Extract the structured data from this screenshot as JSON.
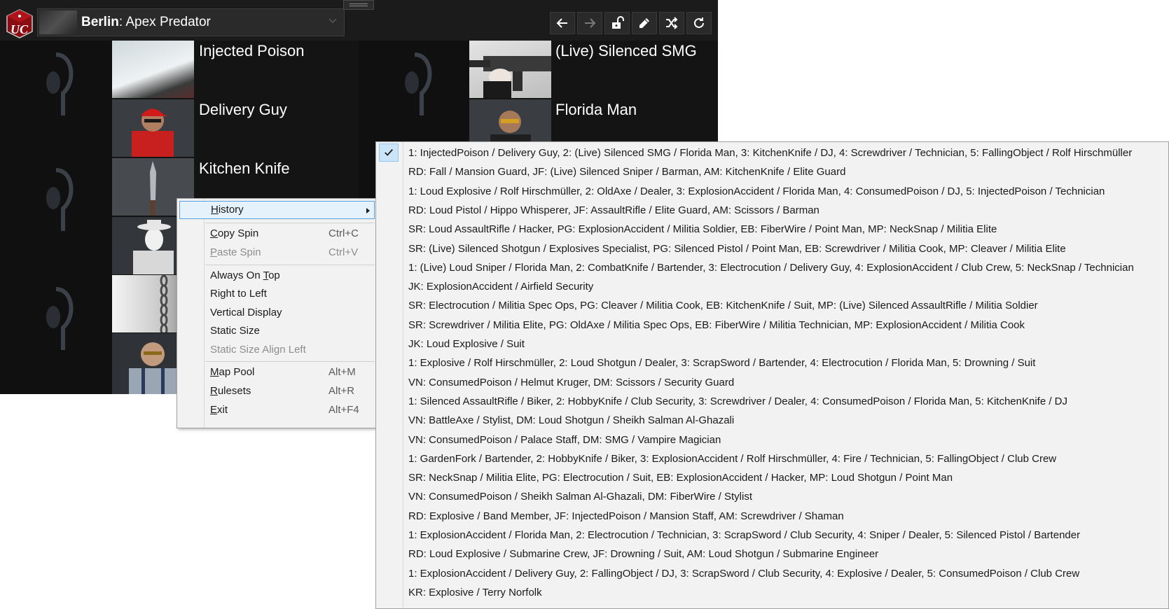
{
  "app": {
    "mission": {
      "location": "Berlin",
      "name": "Apex Predator"
    },
    "toolbar_buttons": [
      "back-arrow-icon",
      "forward-arrow-icon",
      "unlock-icon",
      "pencil-icon",
      "shuffle-icon",
      "refresh-icon"
    ]
  },
  "spin": {
    "left_column": [
      {
        "name": "Injected Poison"
      },
      {
        "name": "Delivery Guy"
      },
      {
        "name": "Kitchen Knife"
      }
    ],
    "right_column": [
      {
        "name": "(Live) Silenced SMG"
      },
      {
        "name": "Florida Man"
      }
    ]
  },
  "context_menu": {
    "items": [
      {
        "label": "History",
        "accel": "H",
        "rest": "istory",
        "shortcut": "",
        "submenu": true,
        "enabled": true
      },
      {
        "label": "Copy Spin",
        "accel": "C",
        "rest": "opy Spin",
        "shortcut": "Ctrl+C",
        "enabled": true
      },
      {
        "label": "Paste Spin",
        "accel": "P",
        "rest": "aste Spin",
        "shortcut": "Ctrl+V",
        "enabled": false
      },
      {
        "label_pre": "Always On ",
        "accel": "T",
        "rest": "op",
        "shortcut": "",
        "enabled": true
      },
      {
        "label": "Right to Left",
        "shortcut": "",
        "enabled": true
      },
      {
        "label": "Vertical Display",
        "shortcut": "",
        "enabled": true
      },
      {
        "label": "Static Size",
        "shortcut": "",
        "enabled": true
      },
      {
        "label": "Static Size Align Left",
        "shortcut": "",
        "enabled": false
      },
      {
        "label": "Map Pool",
        "accel": "M",
        "rest": "ap Pool",
        "shortcut": "Alt+M",
        "enabled": true
      },
      {
        "label": "Rulesets",
        "accel": "R",
        "rest": "ulesets",
        "shortcut": "Alt+R",
        "enabled": true
      },
      {
        "label": "Exit",
        "accel": "E",
        "rest": "xit",
        "shortcut": "Alt+F4",
        "enabled": true
      }
    ]
  },
  "history": {
    "checked_index": 0,
    "entries": [
      "1: InjectedPoison / Delivery Guy, 2: (Live) Silenced SMG / Florida Man, 3: KitchenKnife / DJ, 4: Screwdriver / Technician, 5: FallingObject / Rolf Hirschmüller",
      "RD: Fall / Mansion Guard, JF: (Live) Silenced Sniper / Barman, AM: KitchenKnife / Elite Guard",
      "1: Loud Explosive / Rolf Hirschmüller, 2: OldAxe / Dealer, 3: ExplosionAccident / Florida Man, 4: ConsumedPoison / DJ, 5: InjectedPoison / Technician",
      "RD: Loud Pistol / Hippo Whisperer, JF: AssaultRifle / Elite Guard, AM: Scissors / Barman",
      "SR: Loud AssaultRifle / Hacker, PG: ExplosionAccident / Militia Soldier, EB: FiberWire / Point Man, MP: NeckSnap / Militia Elite",
      "SR: (Live) Silenced Shotgun / Explosives Specialist, PG: Silenced Pistol / Point Man, EB: Screwdriver / Militia Cook, MP: Cleaver / Militia Elite",
      "1: (Live) Loud Sniper / Florida Man, 2: CombatKnife / Bartender, 3: Electrocution / Delivery Guy, 4: ExplosionAccident / Club Crew, 5: NeckSnap / Technician",
      "JK: ExplosionAccident / Airfield Security",
      "SR: Electrocution / Militia Spec Ops, PG: Cleaver / Militia Cook, EB: KitchenKnife / Suit, MP: (Live) Silenced AssaultRifle / Militia Soldier",
      "SR: Screwdriver / Militia Elite, PG: OldAxe / Militia Spec Ops, EB: FiberWire / Militia Technician, MP: ExplosionAccident / Militia Cook",
      "JK: Loud Explosive / Suit",
      "1: Explosive / Rolf Hirschmüller, 2: Loud Shotgun / Dealer, 3: ScrapSword / Bartender, 4: Electrocution / Florida Man, 5: Drowning / Suit",
      "VN: ConsumedPoison / Helmut Kruger, DM: Scissors / Security Guard",
      "1: Silenced AssaultRifle / Biker, 2: HobbyKnife / Club Security, 3: Screwdriver / Dealer, 4: ConsumedPoison / Florida Man, 5: KitchenKnife / DJ",
      "VN: BattleAxe / Stylist, DM: Loud Shotgun / Sheikh Salman Al-Ghazali",
      "VN: ConsumedPoison / Palace Staff, DM: SMG / Vampire Magician",
      "1: GardenFork / Bartender, 2: HobbyKnife / Biker, 3: ExplosionAccident / Rolf Hirschmüller, 4: Fire / Technician, 5: FallingObject / Club Crew",
      "SR: NeckSnap / Militia Elite, PG: Electrocution / Suit, EB: ExplosionAccident / Hacker, MP: Loud Shotgun / Point Man",
      "VN: ConsumedPoison / Sheikh Salman Al-Ghazali, DM: FiberWire / Stylist",
      "RD: Explosive / Band Member, JF: InjectedPoison / Mansion Staff, AM: Screwdriver / Shaman",
      "1: ExplosionAccident / Florida Man, 2: Electrocution / Technician, 3: ScrapSword / Club Security, 4: Sniper / Dealer, 5: Silenced Pistol / Bartender",
      "RD: Loud Explosive / Submarine Crew, JF: Drowning / Suit, AM: Loud Shotgun / Submarine Engineer",
      "1: ExplosionAccident / Delivery Guy, 2: FallingObject / DJ, 3: ScrapSword / Club Security, 4: Explosive / Dealer, 5: ConsumedPoison / Club Crew",
      "KR: Explosive / Terry Norfolk"
    ]
  }
}
